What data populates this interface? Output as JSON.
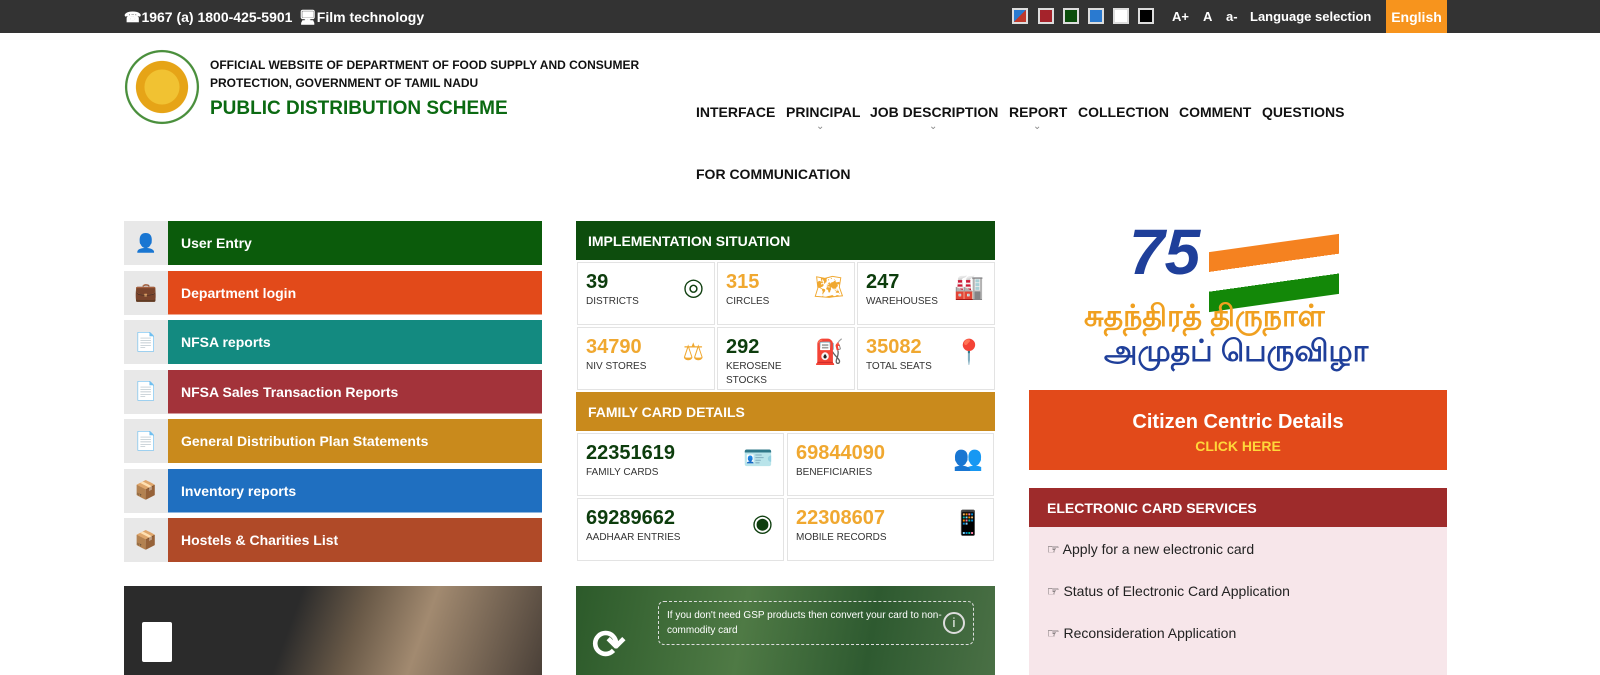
{
  "topbar": {
    "phone": "☎1967 (a) 1800-425-5901",
    "film": "🖥Film technology",
    "swatches": [
      "#c0392b",
      "#a5232b",
      "#0b4d0b",
      "#2a7ad0",
      "#ffffff",
      "#000000"
    ],
    "font_large": "A+",
    "font_normal": "A",
    "font_small": "a-",
    "language_label": "Language selection",
    "language_value": "English"
  },
  "header": {
    "line1": "OFFICIAL WEBSITE OF DEPARTMENT OF FOOD SUPPLY AND CONSUMER PROTECTION, GOVERNMENT OF TAMIL NADU",
    "title": "PUBLIC DISTRIBUTION SCHEME"
  },
  "nav": [
    {
      "label": "INTERFACE"
    },
    {
      "label": "PRINCIPAL",
      "dropdown": true
    },
    {
      "label": "JOB DESCRIPTION",
      "dropdown": true
    },
    {
      "label": "REPORT",
      "dropdown": true
    },
    {
      "label": "COLLECTION"
    },
    {
      "label": "COMMENT"
    },
    {
      "label": "QUESTIONS"
    },
    {
      "label": "FOR COMMUNICATION"
    }
  ],
  "menu": [
    {
      "label": "User Entry",
      "color": "#0b5b0b",
      "icon": "user-icon"
    },
    {
      "label": "Department login",
      "color": "#e24a1a",
      "icon": "briefcase-icon"
    },
    {
      "label": "NFSA reports",
      "color": "#138a80",
      "icon": "document-icon"
    },
    {
      "label": "NFSA Sales Transaction Reports",
      "color": "#a3333a",
      "icon": "document-icon"
    },
    {
      "label": "General Distribution Plan Statements",
      "color": "#c98a1c",
      "icon": "document-icon"
    },
    {
      "label": "Inventory reports",
      "color": "#1f6fc0",
      "icon": "boxes-icon"
    },
    {
      "label": "Hostels & Charities List",
      "color": "#b04a28",
      "icon": "boxes-icon"
    }
  ],
  "implementation": {
    "title": "IMPLEMENTATION SITUATION",
    "items": [
      {
        "value": "39",
        "label": "DISTRICTS",
        "color": "#0d3d0d",
        "icon": "map-pin-icon"
      },
      {
        "value": "315",
        "label": "CIRCLES",
        "color": "#f0a830",
        "icon": "map-icon"
      },
      {
        "value": "247",
        "label": "WAREHOUSES",
        "color": "#0d3d0d",
        "icon": "warehouse-icon"
      },
      {
        "value": "34790",
        "label": "NIV STORES",
        "color": "#f0a830",
        "icon": "scales-icon"
      },
      {
        "value": "292",
        "label": "KEROSENE STOCKS",
        "color": "#0d3d0d",
        "icon": "fuel-pump-icon"
      },
      {
        "value": "35082",
        "label": "TOTAL SEATS",
        "color": "#f0a830",
        "icon": "location-icon"
      }
    ]
  },
  "family": {
    "title": "FAMILY CARD DETAILS",
    "items": [
      {
        "value": "22351619",
        "label": "FAMILY CARDS",
        "color": "#0d3d0d",
        "icon": "id-card-icon"
      },
      {
        "value": "69844090",
        "label": "BENEFICIARIES",
        "color": "#f0a830",
        "icon": "users-icon"
      },
      {
        "value": "69289662",
        "label": "AADHAAR ENTRIES",
        "color": "#0d3d0d",
        "icon": "aadhaar-icon"
      },
      {
        "value": "22308607",
        "label": "MOBILE RECORDS",
        "color": "#f0a830",
        "icon": "mobile-icon"
      }
    ]
  },
  "banner": {
    "number": "75",
    "line1": "சுதந்திரத் திருநாள்",
    "line2": "அமுதப் பெருவிழா"
  },
  "citizen": {
    "title": "Citizen Centric Details",
    "cta": "CLICK HERE"
  },
  "ecard": {
    "title": "ELECTRONIC CARD SERVICES",
    "items": [
      "Apply for a new electronic card",
      "Status of Electronic Card Application",
      "Reconsideration Application"
    ]
  },
  "gsp": {
    "text": "If you don't need GSP products then convert your card to non-commodity card"
  }
}
